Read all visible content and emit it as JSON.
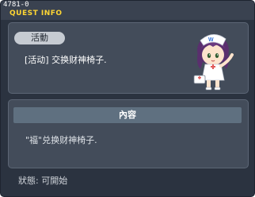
{
  "window": {
    "quest_id": "4781-0",
    "title": "QUEST INFO"
  },
  "quest": {
    "category": "活動",
    "name": "[活动] 交换财神椅子.",
    "npc_icon": "nurse-npc-icon"
  },
  "content": {
    "header": "內容",
    "description": "\"福\"兑换财神椅子."
  },
  "status": {
    "text": "狀態:  可開始"
  },
  "colors": {
    "title": "#ffd633",
    "window_bg": "#2b3340",
    "panel_bg": "#434c5a",
    "header_bg": "#5f7080",
    "pill_bg": "#c6cbd2"
  }
}
